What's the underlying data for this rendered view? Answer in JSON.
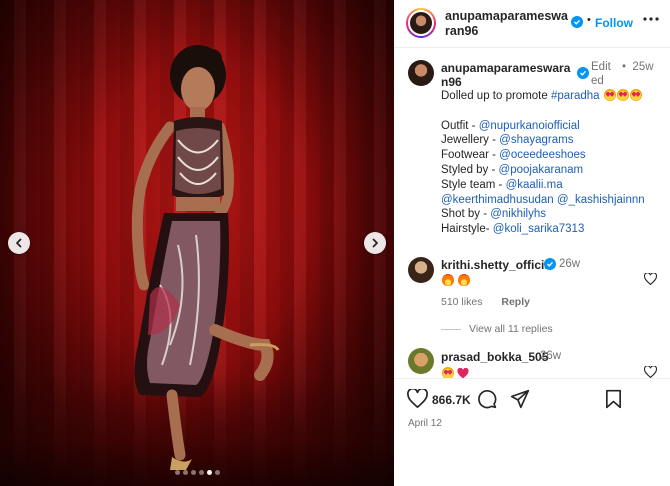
{
  "photo": {
    "carousel_dots": 6,
    "active_dot": 4
  },
  "header": {
    "username": "anupamaparameswaran96",
    "dot": "•",
    "follow_label": "Follow"
  },
  "caption": {
    "username": "anupamaparameswaran96",
    "edited": "Edited",
    "dot": "•",
    "time": "25w",
    "lines": [
      {
        "text": "Dolled up to promote ",
        "link": "#paradha",
        "emojis": 3
      },
      {
        "gap": true
      },
      {
        "text": "Outfit - ",
        "link": "@nupurkanoiofficial"
      },
      {
        "text": "Jewellery - ",
        "link": "@shayagrams"
      },
      {
        "text": "Footwear - ",
        "link": "@oceedeeshoes"
      },
      {
        "text": "Styled by - ",
        "link": "@poojakaranam"
      },
      {
        "text": "Style team - ",
        "link": "@kaalii.ma"
      },
      {
        "text": "",
        "link": "@keerthimadhusudan @_kashishjainnn"
      },
      {
        "text": "Shot by - ",
        "link": "@nikhilyhs"
      },
      {
        "text": "Hairstyle- ",
        "link": "@koli_sarika7313"
      }
    ]
  },
  "comment1": {
    "username": "krithi.shetty_official",
    "time": "26w",
    "likes": "510 likes",
    "reply": "Reply",
    "view_replies": "View all 11 replies"
  },
  "comment2": {
    "username": "prasad_bokka_505",
    "time": "26w"
  },
  "actions": {
    "like_count": "866.7K",
    "date": "April 12"
  },
  "colors": {
    "accent": "#0095f6",
    "link": "#1e5fb4",
    "muted": "#737373",
    "background_red": "#9a0d0d"
  }
}
